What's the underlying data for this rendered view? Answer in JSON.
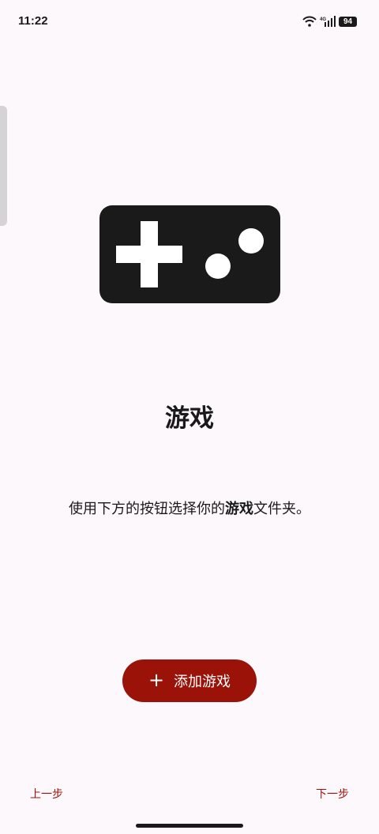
{
  "status_bar": {
    "time": "11:22",
    "network_label": "4G",
    "battery_level": "94",
    "icons": [
      "wifi-icon",
      "signal-icon",
      "battery-icon"
    ]
  },
  "hero": {
    "icon": "gamepad-icon",
    "title": "游戏"
  },
  "description": {
    "before": "使用下方的按钮选择你的",
    "bold": "游戏",
    "after": "文件夹。"
  },
  "add_button": {
    "icon": "plus-icon",
    "label": "添加游戏"
  },
  "navigation": {
    "prev_label": "上一步",
    "next_label": "下一步"
  },
  "colors": {
    "background": "#fdf8fb",
    "accent": "#9a1208",
    "icon_fill": "#1a1a1a"
  }
}
